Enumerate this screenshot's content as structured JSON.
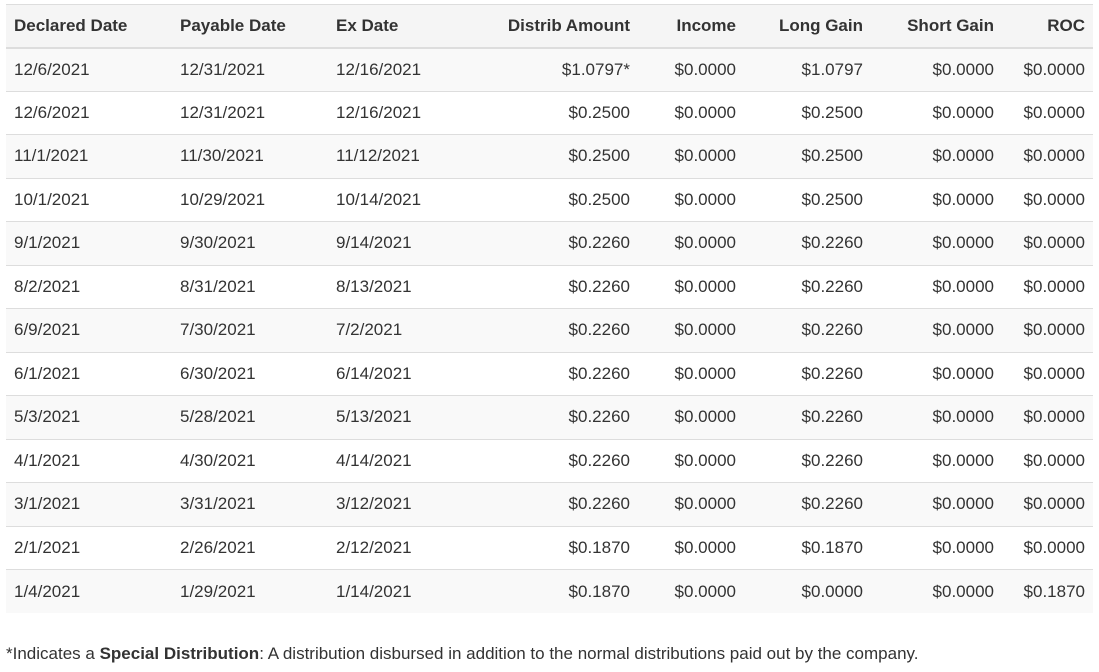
{
  "table": {
    "headers": [
      "Declared Date",
      "Payable Date",
      "Ex Date",
      "Distrib Amount",
      "Income",
      "Long Gain",
      "Short Gain",
      "ROC"
    ],
    "rows": [
      [
        "12/6/2021",
        "12/31/2021",
        "12/16/2021",
        "$1.0797*",
        "$0.0000",
        "$1.0797",
        "$0.0000",
        "$0.0000"
      ],
      [
        "12/6/2021",
        "12/31/2021",
        "12/16/2021",
        "$0.2500",
        "$0.0000",
        "$0.2500",
        "$0.0000",
        "$0.0000"
      ],
      [
        "11/1/2021",
        "11/30/2021",
        "11/12/2021",
        "$0.2500",
        "$0.0000",
        "$0.2500",
        "$0.0000",
        "$0.0000"
      ],
      [
        "10/1/2021",
        "10/29/2021",
        "10/14/2021",
        "$0.2500",
        "$0.0000",
        "$0.2500",
        "$0.0000",
        "$0.0000"
      ],
      [
        "9/1/2021",
        "9/30/2021",
        "9/14/2021",
        "$0.2260",
        "$0.0000",
        "$0.2260",
        "$0.0000",
        "$0.0000"
      ],
      [
        "8/2/2021",
        "8/31/2021",
        "8/13/2021",
        "$0.2260",
        "$0.0000",
        "$0.2260",
        "$0.0000",
        "$0.0000"
      ],
      [
        "6/9/2021",
        "7/30/2021",
        "7/2/2021",
        "$0.2260",
        "$0.0000",
        "$0.2260",
        "$0.0000",
        "$0.0000"
      ],
      [
        "6/1/2021",
        "6/30/2021",
        "6/14/2021",
        "$0.2260",
        "$0.0000",
        "$0.2260",
        "$0.0000",
        "$0.0000"
      ],
      [
        "5/3/2021",
        "5/28/2021",
        "5/13/2021",
        "$0.2260",
        "$0.0000",
        "$0.2260",
        "$0.0000",
        "$0.0000"
      ],
      [
        "4/1/2021",
        "4/30/2021",
        "4/14/2021",
        "$0.2260",
        "$0.0000",
        "$0.2260",
        "$0.0000",
        "$0.0000"
      ],
      [
        "3/1/2021",
        "3/31/2021",
        "3/12/2021",
        "$0.2260",
        "$0.0000",
        "$0.2260",
        "$0.0000",
        "$0.0000"
      ],
      [
        "2/1/2021",
        "2/26/2021",
        "2/12/2021",
        "$0.1870",
        "$0.0000",
        "$0.1870",
        "$0.0000",
        "$0.0000"
      ],
      [
        "1/4/2021",
        "1/29/2021",
        "1/14/2021",
        "$0.1870",
        "$0.0000",
        "$0.0000",
        "$0.0000",
        "$0.1870"
      ]
    ]
  },
  "footnote": {
    "prefix": "*Indicates a ",
    "emphasis": "Special Distribution",
    "suffix": ": A distribution disbursed in addition to the normal distributions paid out by the company."
  }
}
